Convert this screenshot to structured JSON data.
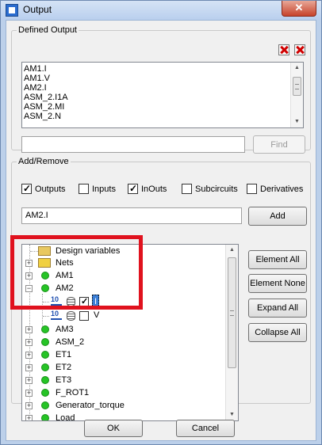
{
  "window": {
    "title": "Output",
    "close_glyph": "✕"
  },
  "defined_output": {
    "legend": "Defined Output",
    "items": [
      "AM1.I",
      "AM1.V",
      "AM2.I",
      "ASM_2.I1A",
      "ASM_2.MI",
      "ASM_2.N"
    ],
    "find_value": "",
    "find_label": "Find"
  },
  "add_remove": {
    "legend": "Add/Remove",
    "checkboxes": [
      {
        "label": "Outputs",
        "checked": true
      },
      {
        "label": "Inputs",
        "checked": false
      },
      {
        "label": "InOuts",
        "checked": true
      },
      {
        "label": "Subcircuits",
        "checked": false
      },
      {
        "label": "Derivatives",
        "checked": false
      }
    ],
    "input_value": "AM2.I",
    "add_label": "Add",
    "buttons": {
      "element_all": "Element All",
      "element_none": "Element None",
      "expand_all": "Expand All",
      "collapse_all": "Collapse All"
    },
    "tree": {
      "design_variables": "Design variables",
      "nets": "Nets",
      "am1": "AM1",
      "am2": "AM2",
      "am2_i_num": "10",
      "am2_i_label": "I",
      "am2_v_num": "10",
      "am2_v_label": "V",
      "am3": "AM3",
      "asm2": "ASM_2",
      "et1": "ET1",
      "et2": "ET2",
      "et3": "ET3",
      "f_rot1": "F_ROT1",
      "generator_torque": "Generator_torque",
      "load": "Load"
    }
  },
  "footer": {
    "ok_label": "OK",
    "cancel_label": "Cancel"
  },
  "colors": {
    "highlight": "#e0121e",
    "node_dot": "#26c426",
    "selection": "#3b7fd8"
  }
}
